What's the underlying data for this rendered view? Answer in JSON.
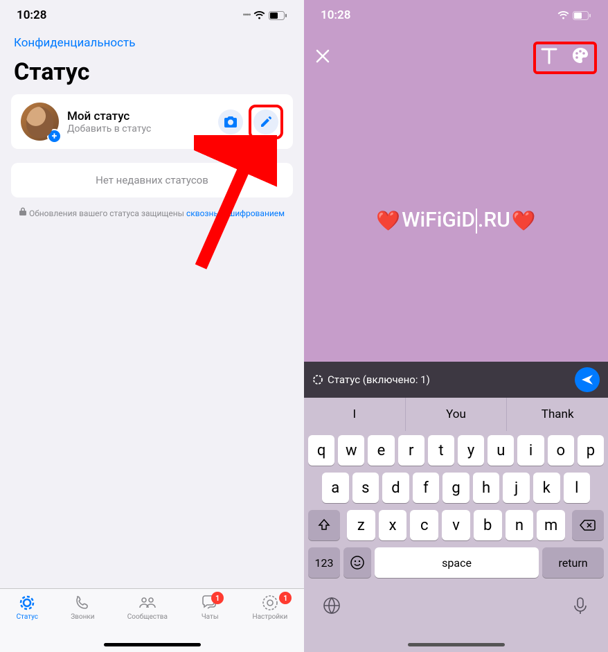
{
  "left": {
    "time": "10:28",
    "privacy": "Конфиденциальность",
    "title": "Статус",
    "myStatus": {
      "title": "Мой статус",
      "subtitle": "Добавить в статус"
    },
    "empty": "Нет недавних статусов",
    "encryptPrefix": "Обновления вашего статуса защищены ",
    "encryptLink": "сквозным шифрованием",
    "tabs": {
      "status": "Статус",
      "calls": "Звонки",
      "communities": "Сообщества",
      "chats": "Чаты",
      "settings": "Настройки",
      "chatsBadge": "1",
      "settingsBadge": "1"
    }
  },
  "right": {
    "time": "10:28",
    "statusText": "WiFiGiD.RU",
    "sendBar": "Статус (включено: 1)",
    "suggestions": [
      "I",
      "You",
      "Thank"
    ],
    "keyboard": {
      "row1": [
        "q",
        "w",
        "e",
        "r",
        "t",
        "y",
        "u",
        "i",
        "o",
        "p"
      ],
      "row2": [
        "a",
        "s",
        "d",
        "f",
        "g",
        "h",
        "j",
        "k",
        "l"
      ],
      "row3": [
        "z",
        "x",
        "c",
        "v",
        "b",
        "n",
        "m"
      ],
      "numKey": "123",
      "space": "space",
      "return": "return"
    }
  }
}
